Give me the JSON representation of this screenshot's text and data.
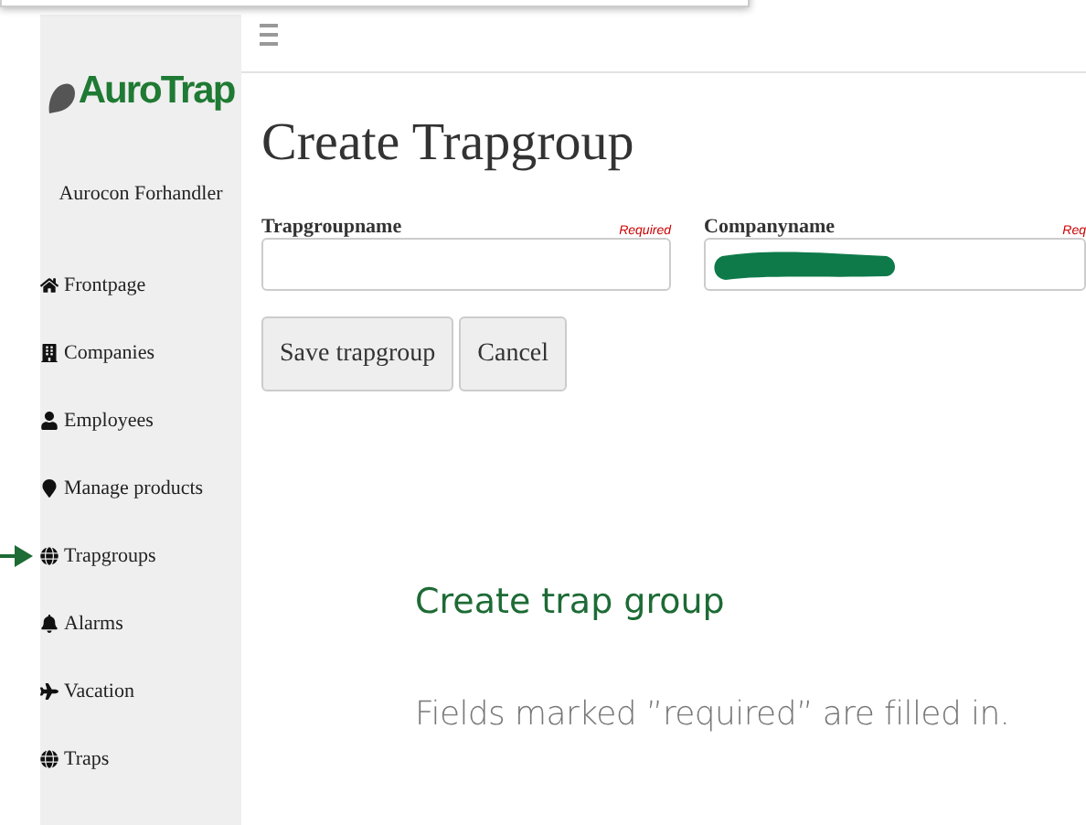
{
  "sidebar": {
    "logo": "AuroTrap",
    "account": "Aurocon Forhandler",
    "items": [
      {
        "label": "Frontpage"
      },
      {
        "label": "Companies"
      },
      {
        "label": "Employees"
      },
      {
        "label": "Manage products"
      },
      {
        "label": "Trapgroups"
      },
      {
        "label": "Alarms"
      },
      {
        "label": "Vacation"
      },
      {
        "label": "Traps"
      }
    ]
  },
  "page": {
    "title": "Create Trapgroup",
    "fields": [
      {
        "label": "Trapgroupname",
        "required": "Required",
        "redacted": false
      },
      {
        "label": "Companyname",
        "required": "Req",
        "redacted": true
      }
    ],
    "buttons": [
      "Save trapgroup",
      "Cancel"
    ]
  },
  "help": {
    "heading": "Create trap group",
    "text": "Fields marked ”required” are filled in."
  }
}
